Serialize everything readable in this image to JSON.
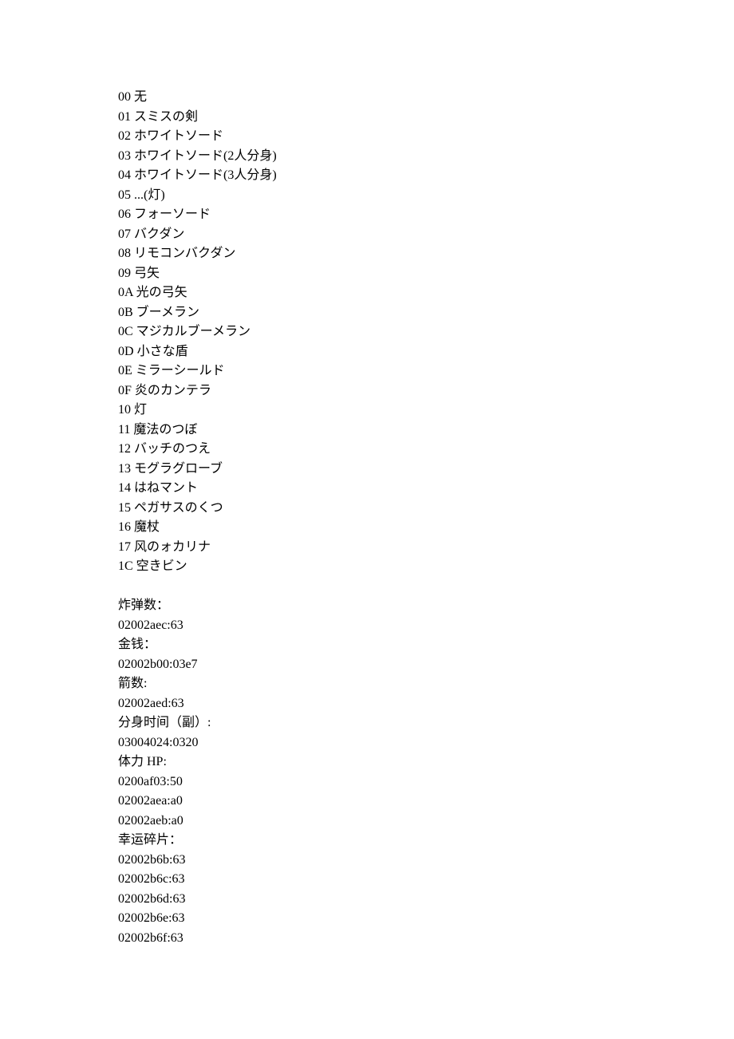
{
  "item_list": [
    {
      "code": "00",
      "name": "无"
    },
    {
      "code": "01",
      "name": "スミスの剣"
    },
    {
      "code": "02",
      "name": "ホワイトソード"
    },
    {
      "code": "03",
      "name": "ホワイトソード(2人分身)"
    },
    {
      "code": "04",
      "name": "ホワイトソード(3人分身)"
    },
    {
      "code": "05",
      "name": "...(灯)"
    },
    {
      "code": "06",
      "name": "フォーソード"
    },
    {
      "code": "07",
      "name": "バクダン"
    },
    {
      "code": "08",
      "name": "リモコンバクダン"
    },
    {
      "code": "09",
      "name": "弓矢"
    },
    {
      "code": "0A",
      "name": "光の弓矢"
    },
    {
      "code": "0B",
      "name": "ブーメラン"
    },
    {
      "code": "0C",
      "name": "マジカルブーメラン"
    },
    {
      "code": "0D",
      "name": "小さな盾"
    },
    {
      "code": "0E",
      "name": "ミラーシールド"
    },
    {
      "code": "0F",
      "name": "炎のカンテラ"
    },
    {
      "code": "10",
      "name": "灯"
    },
    {
      "code": "11",
      "name": "魔法のつぼ"
    },
    {
      "code": "12",
      "name": "バッチのつえ"
    },
    {
      "code": "13",
      "name": "モグラグローブ"
    },
    {
      "code": "14",
      "name": "はねマント"
    },
    {
      "code": "15",
      "name": "ペガサスのくつ"
    },
    {
      "code": "16",
      "name": "魔杖"
    },
    {
      "code": "17",
      "name": "风のォカリナ"
    },
    {
      "code": "1C",
      "name": "空きビン"
    }
  ],
  "sections": {
    "bombs": {
      "label": "炸弹数：",
      "codes": [
        "02002aec:63"
      ]
    },
    "money": {
      "label": "金钱：",
      "codes": [
        "02002b00:03e7"
      ]
    },
    "arrows": {
      "label": "箭数:",
      "codes": [
        "02002aed:63"
      ]
    },
    "clone_time": {
      "label": "分身时间（副）:",
      "codes": [
        "03004024:0320"
      ]
    },
    "hp": {
      "label": "体力 HP:",
      "codes": [
        "0200af03:50",
        "02002aea:a0",
        "02002aeb:a0"
      ]
    },
    "lucky_shards": {
      "label": "幸运碎片：",
      "codes": [
        "02002b6b:63",
        "02002b6c:63",
        "02002b6d:63",
        "02002b6e:63",
        "02002b6f:63"
      ]
    }
  }
}
